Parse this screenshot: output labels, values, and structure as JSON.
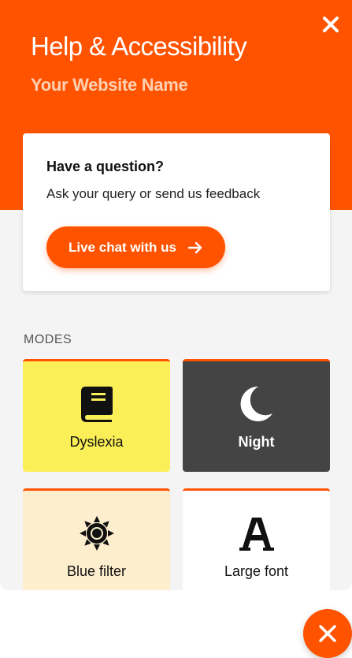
{
  "header": {
    "title": "Help & Accessibility",
    "subtitle": "Your Website Name",
    "close_icon": "close-icon"
  },
  "question_card": {
    "title": "Have a question?",
    "text": "Ask your query or send us feedback",
    "button_label": "Live chat with us",
    "button_icon": "arrow-right-icon"
  },
  "modes": {
    "section_label": "MODES",
    "items": [
      {
        "label": "Dyslexia",
        "icon": "book-icon"
      },
      {
        "label": "Night",
        "icon": "moon-icon"
      },
      {
        "label": "Blue filter",
        "icon": "sun-icon"
      },
      {
        "label": "Large font",
        "icon": "large-font-icon"
      }
    ]
  },
  "fab": {
    "icon": "close-icon"
  },
  "colors": {
    "accent": "#ff5300",
    "dyslexia_bg": "#fbef57",
    "night_bg": "#444444",
    "blue_filter_bg": "#fdefce",
    "large_font_bg": "#ffffff",
    "panel_bg": "#f4f4f4"
  }
}
